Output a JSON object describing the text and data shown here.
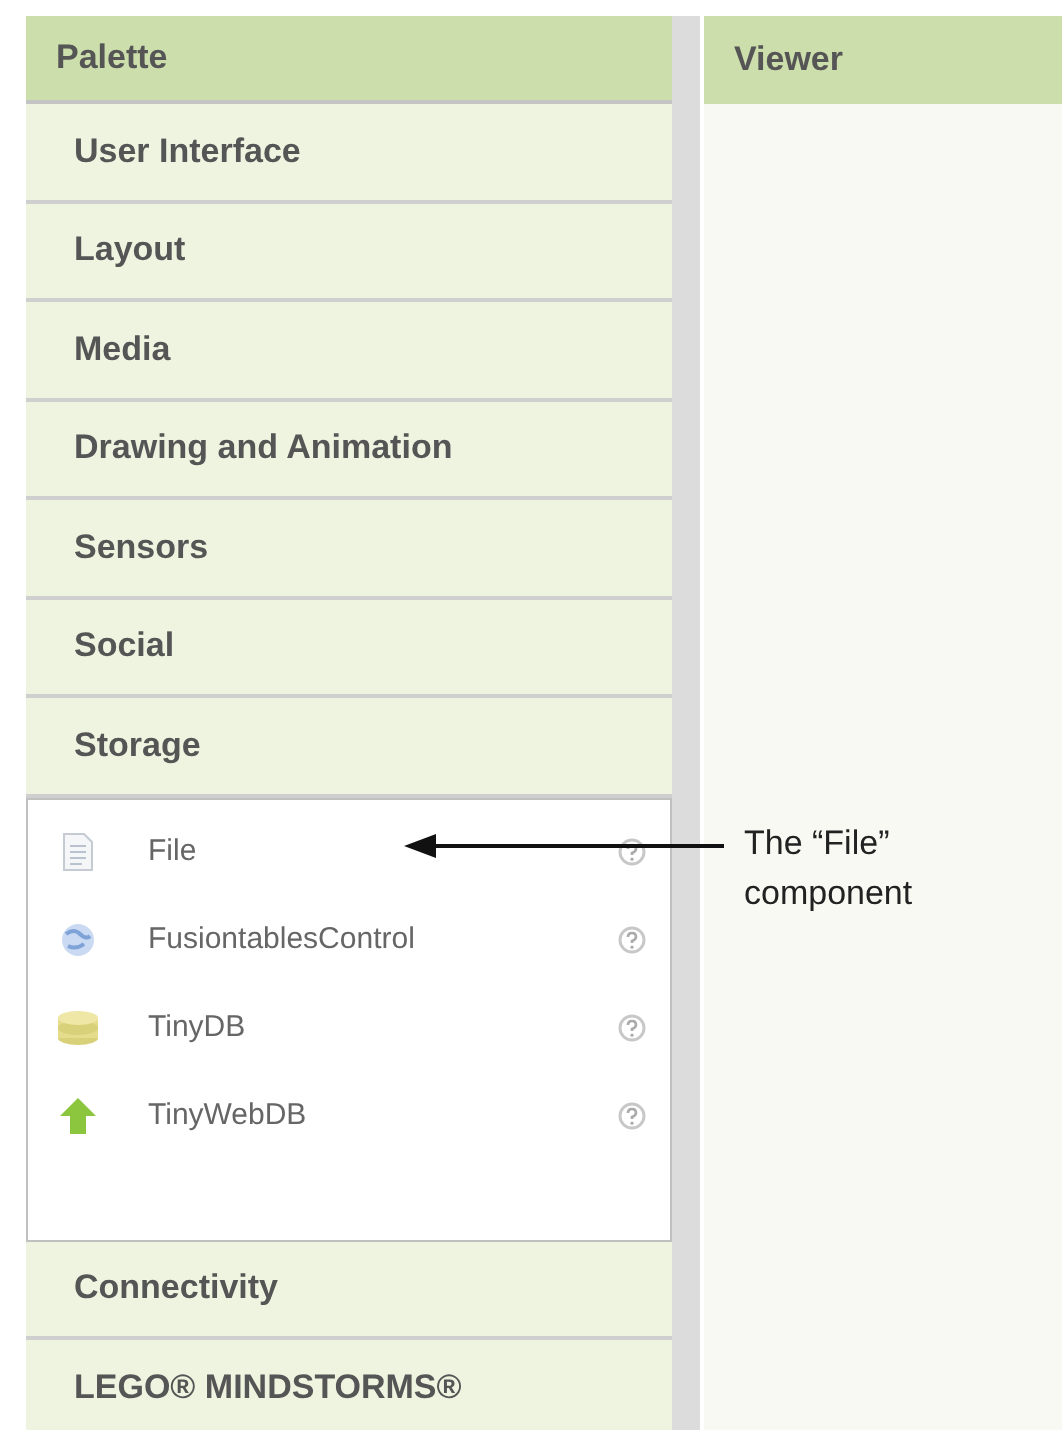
{
  "palette": {
    "title": "Palette",
    "categories": [
      {
        "label": "User Interface"
      },
      {
        "label": "Layout"
      },
      {
        "label": "Media"
      },
      {
        "label": "Drawing and Animation"
      },
      {
        "label": "Sensors"
      },
      {
        "label": "Social"
      },
      {
        "label": "Storage",
        "items": [
          {
            "label": "File",
            "kind": "file"
          },
          {
            "label": "FusiontablesControl",
            "kind": "fusion"
          },
          {
            "label": "TinyDB",
            "kind": "database"
          },
          {
            "label": "TinyWebDB",
            "kind": "upload"
          }
        ]
      },
      {
        "label": "Connectivity"
      },
      {
        "label": "LEGO® MINDSTORMS®"
      }
    ]
  },
  "viewer": {
    "title": "Viewer"
  },
  "annotation": {
    "text": "The “File” component"
  }
}
